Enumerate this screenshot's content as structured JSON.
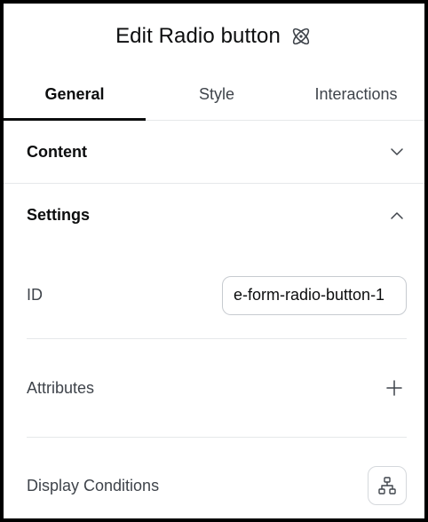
{
  "header": {
    "title": "Edit Radio button",
    "icon": "atom-icon"
  },
  "tabs": [
    {
      "label": "General",
      "active": true
    },
    {
      "label": "Style",
      "active": false
    },
    {
      "label": "Interactions",
      "active": false
    }
  ],
  "sections": {
    "content": {
      "label": "Content",
      "expanded": false,
      "icon": "chevron-down-icon"
    },
    "settings": {
      "label": "Settings",
      "expanded": true,
      "icon": "chevron-up-icon",
      "id_label": "ID",
      "id_value": "e-form-radio-button-1",
      "attributes_label": "Attributes",
      "attributes_icon": "plus-icon",
      "display_conditions_label": "Display Conditions",
      "display_conditions_icon": "sitemap-icon"
    }
  },
  "colors": {
    "text_primary": "#0c0d0e",
    "text_secondary": "#3f444b",
    "border": "#e6e8ea",
    "frame": "#000000"
  }
}
